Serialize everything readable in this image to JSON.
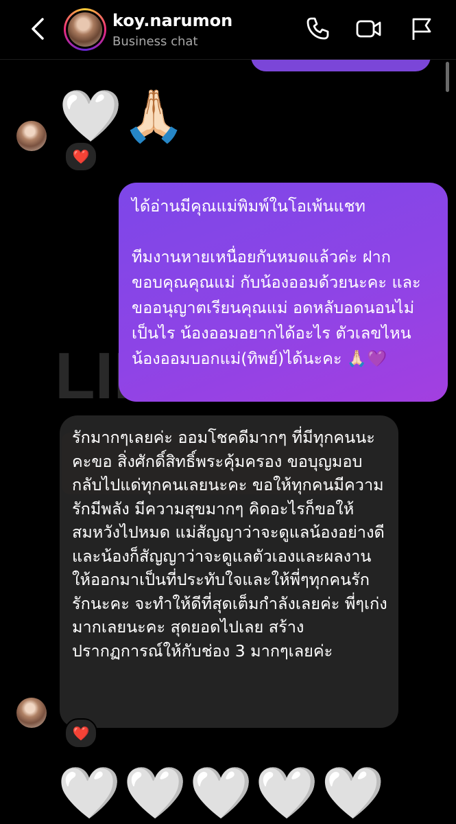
{
  "header": {
    "contact_name": "koy.narumon",
    "subtitle": "Business chat",
    "back_icon": "chevron-left-icon",
    "call_icon": "phone-icon",
    "video_icon": "video-camera-icon",
    "report_icon": "flag-icon"
  },
  "watermark": {
    "text": "LINEAR TREND TAG"
  },
  "messages": {
    "received_emoji": "🤍🙏🏻",
    "received_emoji_reaction": "❤️",
    "sent_paragraph_1": "ได้อ่านมีคุณแม่พิมพ์ในโอเพ้นแชท",
    "sent_paragraph_2": "ทีมงานหายเหนื่อยกันหมดแล้วค่ะ ฝากขอบคุณคุณแม่ กับน้องออมด้วยนะคะ และขออนุญาตเรียนคุณแม่ อดหลับอดนอนไม่เป็นไร น้องออมอยากได้อะไร ตัวเลขไหน น้องออมบอกแม่(ทิพย์)ได้นะคะ 🙏🏻💜",
    "received_text": "รักมากๆเลยค่ะ ออมโชคดีมากๆ ที่มีทุกคนนะคะขอ สิ่งศักดิ์สิทธิ์พระคุ้มครอง ขอบุญมอบกลับไปแด่ทุกคนเลยนะคะ ขอให้ทุกคนมีความรักมีพลัง มีความสุขมากๆ คิดอะไรก็ขอให้สมหวังไปหมด แม่สัญญาว่าจะดูแลน้องอย่างดีและน้องก็สัญญาว่าจะดูแลตัวเองและผลงานให้ออกมาเป็นที่ประทับใจและให้พี่ๆทุกคนรักรักนะคะ จะทำให้ดีที่สุดเต็มกำลังเลยค่ะ พี่ๆเก่งมากเลยนะคะ สุดยอดไปเลย สร้างปรากฏการณ์ให้กับช่อง 3 มากๆเลยค่ะ",
    "received_text_reaction": "❤️",
    "bottom_emoji": "🤍🤍🤍🤍🤍"
  },
  "colors": {
    "background": "#000000",
    "sent_bubble": "#8e44e6",
    "received_bubble": "#262626",
    "reaction_heart": "#ff2d55"
  }
}
